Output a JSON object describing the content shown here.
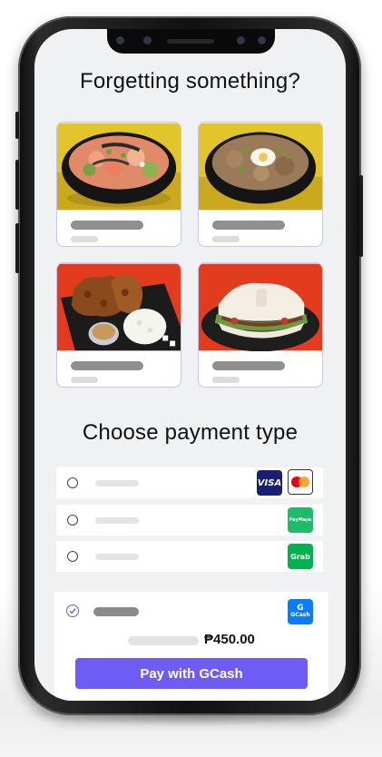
{
  "upsell": {
    "title": "Forgetting something?",
    "items": [
      {
        "image": "poke-bowl"
      },
      {
        "image": "rice-bowl-with-egg"
      },
      {
        "image": "fried-chicken-platter"
      },
      {
        "image": "bao-sandwich"
      }
    ]
  },
  "payment": {
    "title": "Choose payment type",
    "methods": [
      {
        "logos": [
          {
            "icon": "visa-icon",
            "text": "VISA",
            "color": "#1a1f71"
          },
          {
            "icon": "mastercard-icon",
            "text": "",
            "color": "#eb001b"
          }
        ]
      },
      {
        "logos": [
          {
            "icon": "paymaya-icon",
            "text": "PayMaya",
            "color": "#1dbb6a"
          }
        ]
      },
      {
        "logos": [
          {
            "icon": "grab-icon",
            "text": "Grab",
            "color": "#00b14f"
          }
        ]
      }
    ],
    "selected": {
      "logo": {
        "icon": "gcash-icon",
        "text": "GCash",
        "color": "#0a7cff"
      },
      "amount": "₱450.00",
      "button_label": "Pay with GCash"
    }
  },
  "colors": {
    "accent": "#6f5cf5",
    "card_border": "#c9c4ef",
    "screen_bg": "#f0f1f3"
  }
}
